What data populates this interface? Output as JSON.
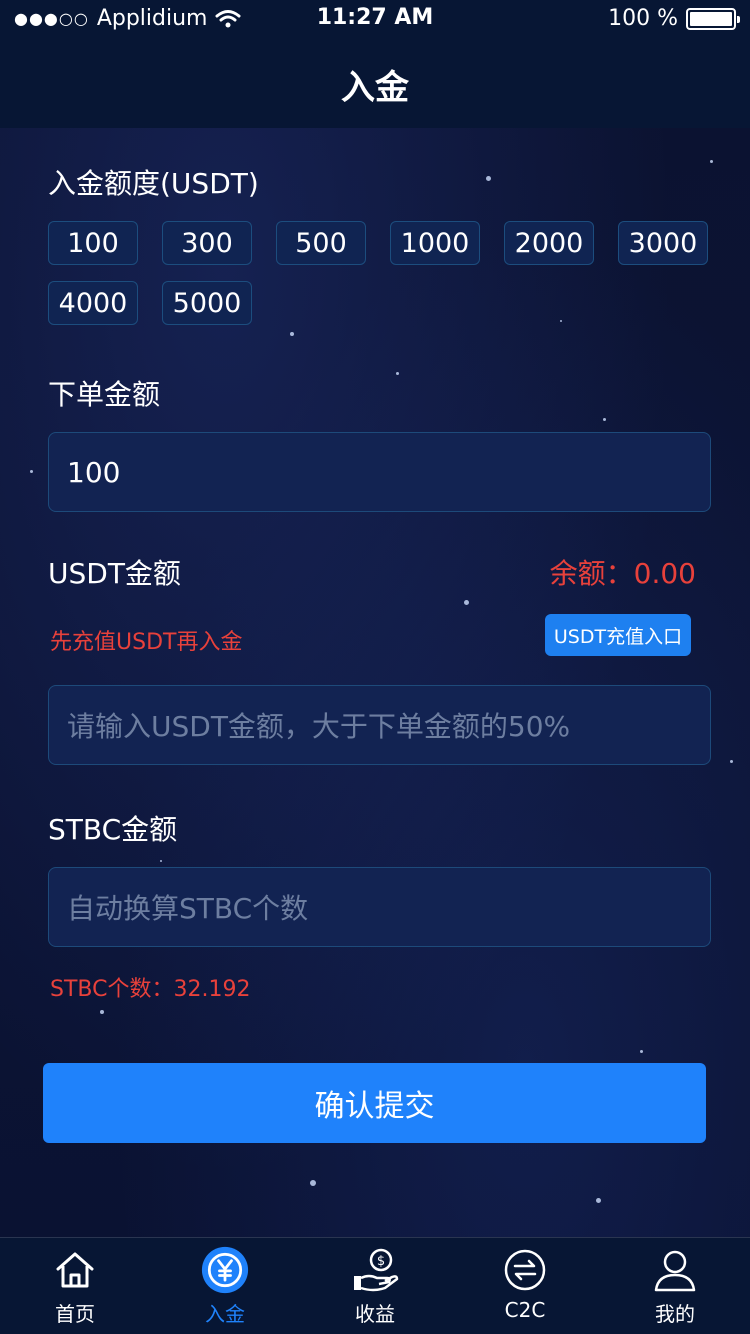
{
  "status_bar": {
    "carrier": "Applidium",
    "time": "11:27 AM",
    "battery": "100 %"
  },
  "nav": {
    "title": "入金"
  },
  "deposit_amount": {
    "label": "入金额度(USDT)",
    "options": [
      "100",
      "300",
      "500",
      "1000",
      "2000",
      "3000",
      "4000",
      "5000"
    ]
  },
  "order_amount": {
    "label": "下单金额",
    "value": "100"
  },
  "usdt": {
    "label": "USDT金额",
    "balance": "余额：0.00",
    "hint": "先充值USDT再入金",
    "recharge_button": "USDT充值入口",
    "placeholder": "请输入USDT金额，大于下单金额的50%"
  },
  "stbc": {
    "label": "STBC金额",
    "placeholder": "自动换算STBC个数",
    "count": "STBC个数：32.192"
  },
  "submit_label": "确认提交",
  "tabs": [
    {
      "label": "首页",
      "icon": "home-icon",
      "active": false
    },
    {
      "label": "入金",
      "icon": "yen-icon",
      "active": true
    },
    {
      "label": "收益",
      "icon": "income-icon",
      "active": false
    },
    {
      "label": "C2C",
      "icon": "exchange-icon",
      "active": false
    },
    {
      "label": "我的",
      "icon": "user-icon",
      "active": false
    }
  ],
  "colors": {
    "accent": "#1f82fb",
    "warning": "#e8413b",
    "background": "#0b1230"
  }
}
